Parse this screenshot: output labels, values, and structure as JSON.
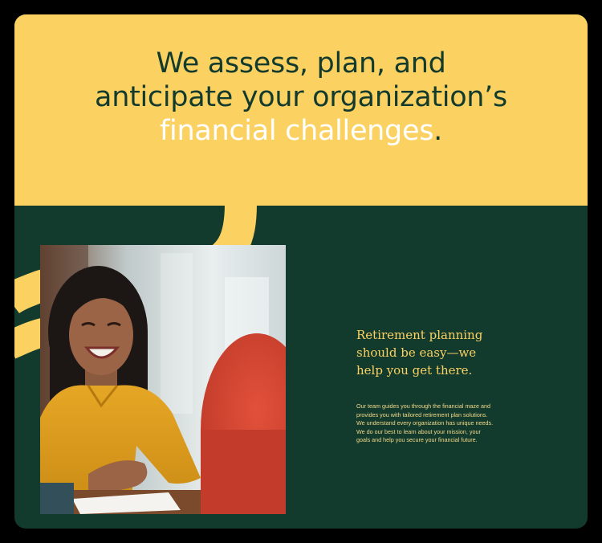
{
  "hero": {
    "headline_line1": "We assess, plan, and",
    "headline_line2": "anticipate your organization’s",
    "headline_accent": "financial challenges",
    "headline_end": ".",
    "background_color": "#fbd162",
    "text_color": "#123b2d",
    "accent_color": "#ffffff"
  },
  "feature": {
    "photo_icon": "smiling-woman-at-desk-photo",
    "subhead_line1": "Retirement planning",
    "subhead_line2": "should be easy—we",
    "subhead_line3": "help you get there.",
    "body_line1": "Our team guides you through the financial maze and",
    "body_line2": "provides you with tailored retirement plan solutions.",
    "body_line3": "We understand every organization has unique needs.",
    "body_line4": "We do our best to learn about your mission, your",
    "body_line5": "goals and help you secure your financial future.",
    "background_color": "#123b2d",
    "subhead_color": "#fbd162"
  }
}
